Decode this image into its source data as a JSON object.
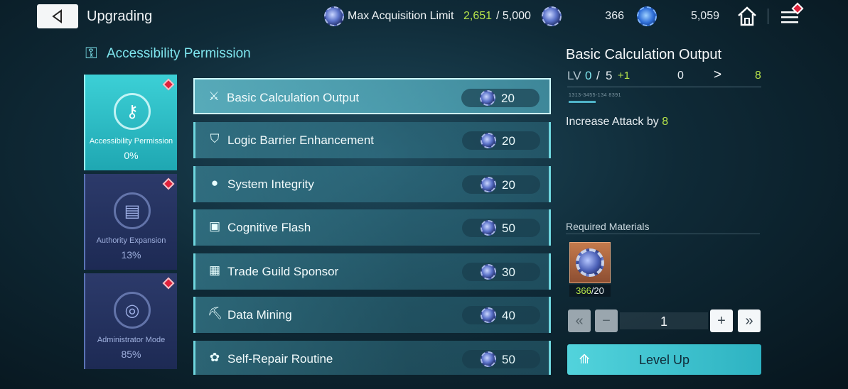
{
  "header": {
    "back_icon": "back-triangle-icon",
    "title": "Upgrading",
    "acquisition_label": "Max Acquisition Limit",
    "acquisition_current": "2,651",
    "acquisition_max": "/ 5,000",
    "resource1_value": "366",
    "resource2_value": "5,059",
    "home_icon": "home-icon",
    "menu_icon": "menu-icon"
  },
  "section": {
    "title": "Accessibility Permission"
  },
  "side_tabs": [
    {
      "label": "Accessibility Permission",
      "percent": "0%",
      "active": true
    },
    {
      "label": "Authority Expansion",
      "percent": "13%",
      "active": false
    },
    {
      "label": "Administrator Mode",
      "percent": "85%",
      "active": false
    }
  ],
  "skills": [
    {
      "name": "Basic Calculation Output",
      "cost": "20",
      "icon": "sword-icon"
    },
    {
      "name": "Logic Barrier Enhancement",
      "cost": "20",
      "icon": "shield-icon"
    },
    {
      "name": "System Integrity",
      "cost": "20",
      "icon": "drop-icon"
    },
    {
      "name": "Cognitive Flash",
      "cost": "50",
      "icon": "card-icon"
    },
    {
      "name": "Trade Guild Sponsor",
      "cost": "30",
      "icon": "shop-icon"
    },
    {
      "name": "Data Mining",
      "cost": "40",
      "icon": "mining-icon"
    },
    {
      "name": "Self-Repair Routine",
      "cost": "50",
      "icon": "repair-icon"
    }
  ],
  "detail": {
    "title": "Basic Calculation Output",
    "lv_label": "LV",
    "lv_current": "0",
    "lv_sep": "/",
    "lv_max": "5",
    "lv_bonus": "+1",
    "stat_from": "0",
    "stat_arrow": ">",
    "stat_to": "8",
    "small_code": "1313-3455-134 8391",
    "effect_prefix": "Increase Attack by ",
    "effect_value": "8"
  },
  "materials": {
    "title": "Required Materials",
    "have": "366",
    "need": "/20"
  },
  "quantity": {
    "value": "1",
    "min_label": "«",
    "dec_label": "−",
    "inc_label": "+",
    "max_label": "»"
  },
  "level_up": {
    "label": "Level Up"
  },
  "colors": {
    "accent_cyan": "#7fe6ef",
    "accent_green": "#b6e34a",
    "alert_red": "#e0213b"
  }
}
